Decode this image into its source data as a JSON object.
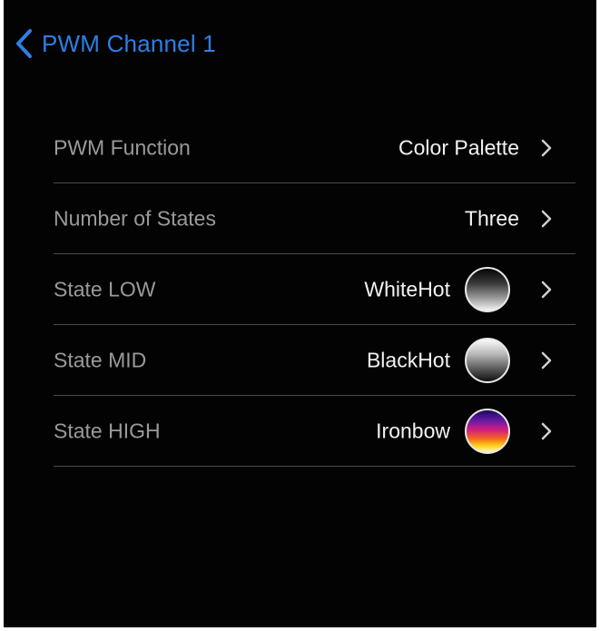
{
  "nav": {
    "back_title": "PWM Channel 1",
    "back_icon": "chevron-left-icon",
    "accent_color": "#2e7fe6"
  },
  "settings": {
    "rows": [
      {
        "label": "PWM Function",
        "value": "Color Palette"
      },
      {
        "label": "Number of States",
        "value": "Three"
      },
      {
        "label": "State LOW",
        "value": "WhiteHot",
        "swatch": "whitehot"
      },
      {
        "label": "State MID",
        "value": "BlackHot",
        "swatch": "blackhot"
      },
      {
        "label": "State HIGH",
        "value": "Ironbow",
        "swatch": "ironbow"
      }
    ]
  },
  "colors": {
    "background": "#030303",
    "label_text": "#9a9a9a",
    "value_text": "#f2f2f2",
    "separator": "#4a4a4a"
  }
}
